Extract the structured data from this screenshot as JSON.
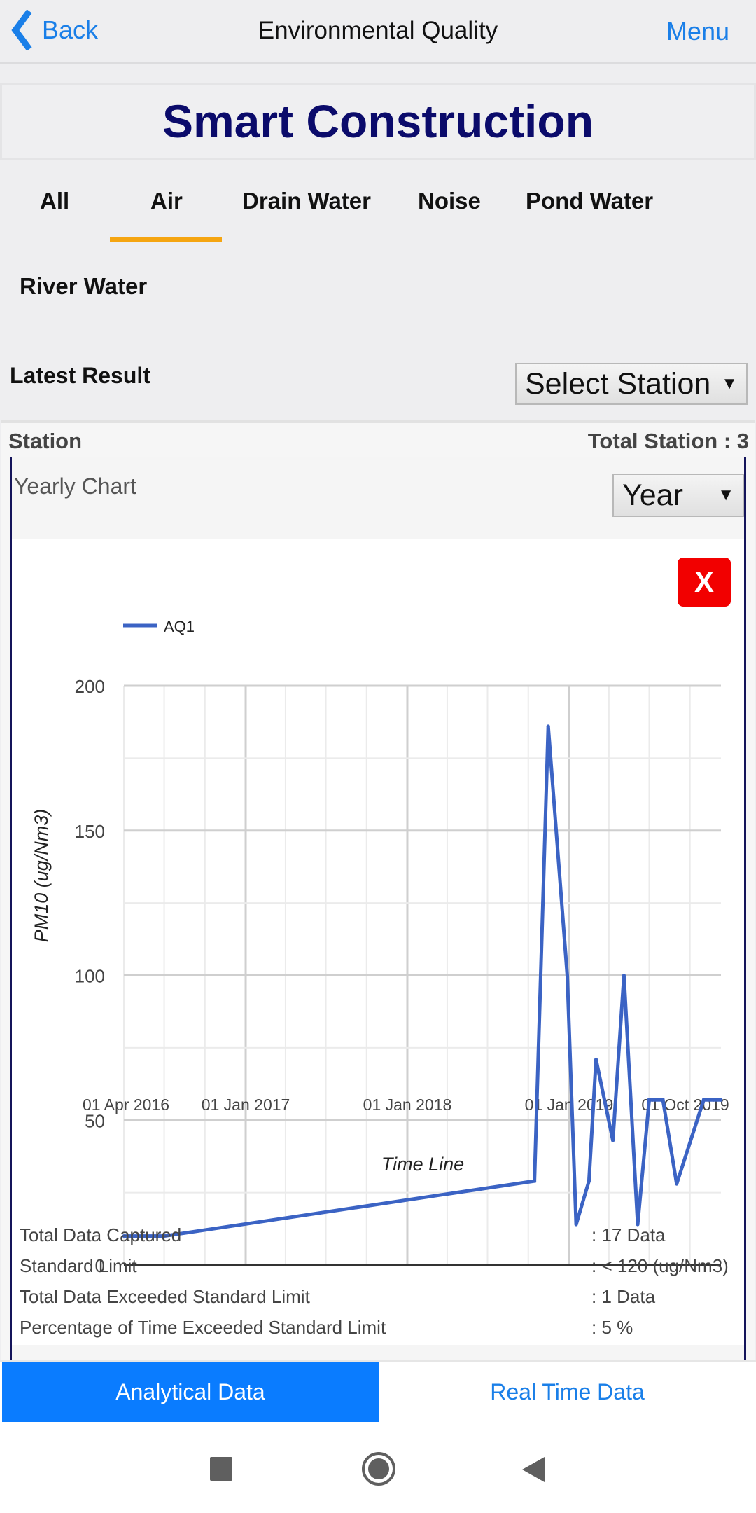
{
  "header": {
    "back_label": "Back",
    "title": "Environmental Quality",
    "menu_label": "Menu"
  },
  "banner": {
    "title": "Smart Construction"
  },
  "tabs": [
    {
      "label": "All"
    },
    {
      "label": "Air",
      "active": true
    },
    {
      "label": "Drain Water"
    },
    {
      "label": "Noise"
    },
    {
      "label": "Pond Water"
    },
    {
      "label": "River Water"
    }
  ],
  "latest": {
    "label": "Latest Result",
    "select_station": "Select Station"
  },
  "station": {
    "label": "Station",
    "total": "Total Station : 3"
  },
  "chart_panel": {
    "title": "Yearly Chart",
    "period_select": "Year",
    "close_label": "X"
  },
  "stats": [
    {
      "label": "Total Data Captured",
      "value": ": 17 Data"
    },
    {
      "label": "Standard Limit",
      "value": ": < 120 (ug/Nm3)"
    },
    {
      "label": "Total Data Exceeded Standard Limit",
      "value": ": 1 Data"
    },
    {
      "label": "Percentage of Time Exceeded Standard Limit",
      "value": ": 5 %"
    }
  ],
  "bottom_tabs": {
    "analytical": "Analytical Data",
    "realtime": "Real Time Data"
  },
  "colors": {
    "accent": "#0a7cff",
    "tab_underline": "#f5a511",
    "series": "#3b63c4",
    "title": "#0b0b6b",
    "close": "#f20000"
  },
  "chart_data": {
    "type": "line",
    "xlabel": "Time Line",
    "ylabel": "PM10 (ug/Nm3)",
    "ylim": [
      0,
      200
    ],
    "yticks": [
      0,
      50,
      100,
      150,
      200
    ],
    "xlim": [
      "2016-04-01",
      "2019-12-10"
    ],
    "xticks": [
      {
        "date": "2016-04-01",
        "label": "01 Apr 2016"
      },
      {
        "date": "2017-01-01",
        "label": "01 Jan 2017"
      },
      {
        "date": "2018-01-01",
        "label": "01 Jan 2018"
      },
      {
        "date": "2019-01-01",
        "label": "01 Jan 2019"
      },
      {
        "date": "2019-10-01",
        "label": "01 Oct 2019"
      }
    ],
    "grid": true,
    "legend": "top-left",
    "series": [
      {
        "name": "AQ1",
        "points": [
          [
            "2016-04-01",
            10
          ],
          [
            "2016-07-01",
            10
          ],
          [
            "2018-10-15",
            29
          ],
          [
            "2018-11-15",
            186
          ],
          [
            "2018-12-28",
            100
          ],
          [
            "2019-01-17",
            14
          ],
          [
            "2019-02-15",
            29
          ],
          [
            "2019-03-03",
            71
          ],
          [
            "2019-04-10",
            43
          ],
          [
            "2019-05-05",
            100
          ],
          [
            "2019-06-05",
            14
          ],
          [
            "2019-07-01",
            57
          ],
          [
            "2019-08-01",
            57
          ],
          [
            "2019-09-01",
            28
          ],
          [
            "2019-11-01",
            57
          ],
          [
            "2019-12-10",
            57
          ]
        ]
      }
    ]
  }
}
